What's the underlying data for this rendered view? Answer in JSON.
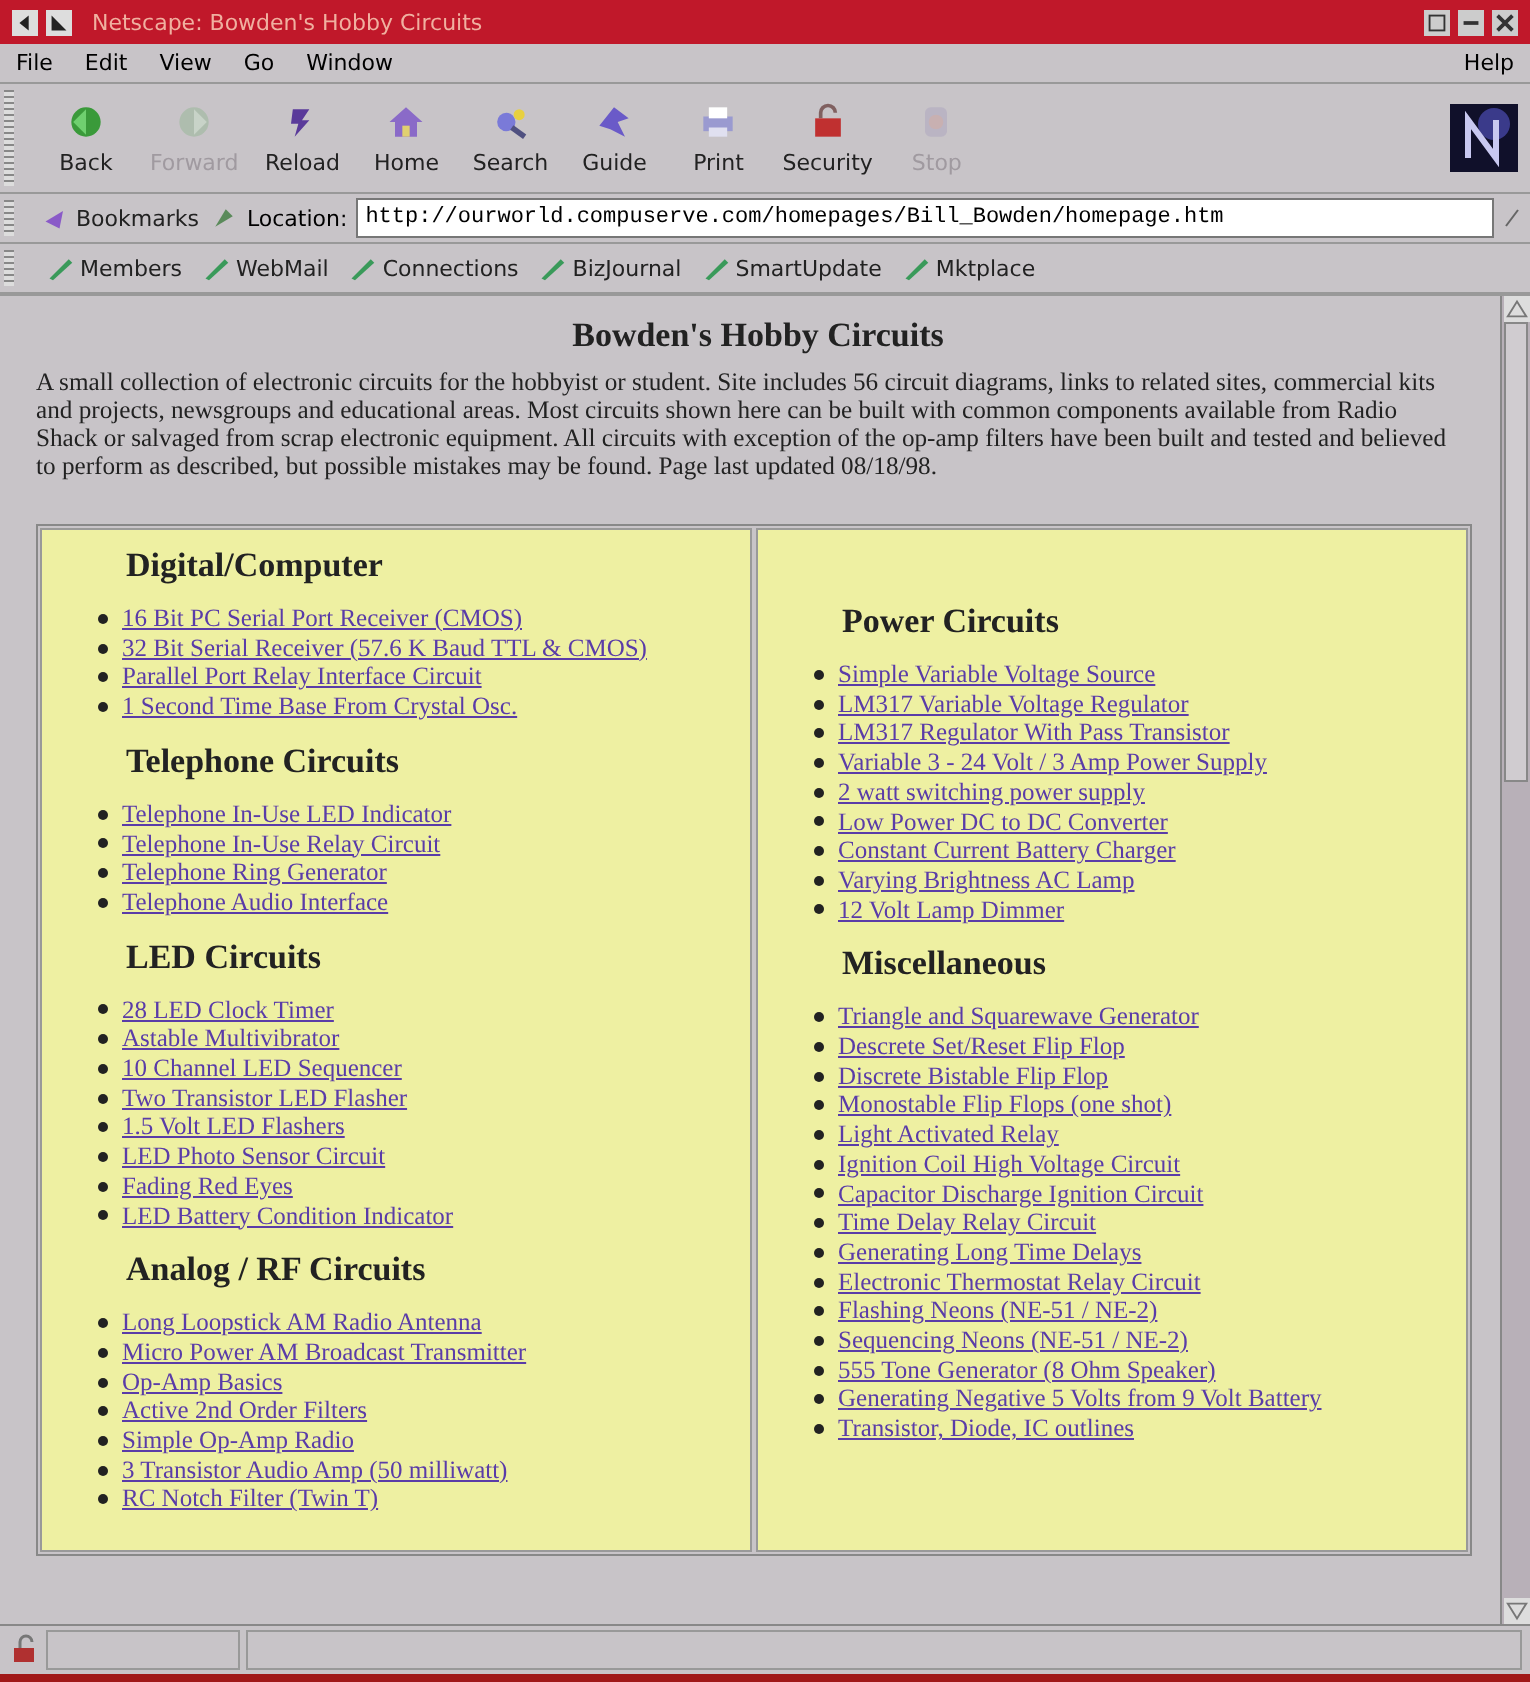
{
  "window": {
    "title": "Netscape: Bowden's Hobby Circuits"
  },
  "menu": {
    "items": [
      "File",
      "Edit",
      "View",
      "Go",
      "Window"
    ],
    "help": "Help"
  },
  "toolbar": [
    {
      "label": "Back",
      "disabled": false
    },
    {
      "label": "Forward",
      "disabled": true
    },
    {
      "label": "Reload",
      "disabled": false
    },
    {
      "label": "Home",
      "disabled": false
    },
    {
      "label": "Search",
      "disabled": false
    },
    {
      "label": "Guide",
      "disabled": false
    },
    {
      "label": "Print",
      "disabled": false
    },
    {
      "label": "Security",
      "disabled": false
    },
    {
      "label": "Stop",
      "disabled": true
    }
  ],
  "location_bar": {
    "bookmarks": "Bookmarks",
    "location_label": "Location:",
    "url": "http://ourworld.compuserve.com/homepages/Bill_Bowden/homepage.htm"
  },
  "personal_toolbar": [
    "Members",
    "WebMail",
    "Connections",
    "BizJournal",
    "SmartUpdate",
    "Mktplace"
  ],
  "page": {
    "title": "Bowden's Hobby Circuits",
    "intro": "A small collection of electronic circuits for the hobbyist or student. Site includes 56 circuit diagrams, links to related sites, commercial kits and projects, newsgroups and educational areas. Most circuits shown here can be built with common components available from Radio Shack or salvaged from scrap electronic equipment. All circuits with exception of the op-amp filters have been built and tested and believed to perform as described, but possible mistakes may be found. Page last updated 08/18/98.",
    "columns": [
      {
        "sections": [
          {
            "heading": "Digital/Computer",
            "links": [
              "16 Bit PC Serial Port Receiver (CMOS)",
              "32 Bit Serial Receiver (57.6 K Baud TTL & CMOS)",
              "Parallel Port Relay Interface Circuit",
              "1 Second Time Base From Crystal Osc."
            ]
          },
          {
            "heading": "Telephone Circuits",
            "links": [
              "Telephone In-Use LED Indicator",
              "Telephone In-Use Relay Circuit",
              "Telephone Ring Generator",
              "Telephone Audio Interface"
            ]
          },
          {
            "heading": "LED Circuits",
            "links": [
              "28 LED Clock Timer",
              "Astable Multivibrator",
              "10 Channel LED Sequencer",
              "Two Transistor LED Flasher",
              "1.5 Volt LED Flashers",
              "LED Photo Sensor Circuit",
              "Fading Red Eyes",
              "LED Battery Condition Indicator"
            ]
          },
          {
            "heading": "Analog / RF Circuits",
            "links": [
              "Long Loopstick AM Radio Antenna",
              "Micro Power AM Broadcast Transmitter",
              "Op-Amp Basics",
              "Active 2nd Order Filters",
              "Simple Op-Amp Radio",
              "3 Transistor Audio Amp (50 milliwatt)",
              "RC Notch Filter (Twin T)"
            ]
          }
        ]
      },
      {
        "sections": [
          {
            "heading": "Power Circuits",
            "links": [
              "Simple Variable Voltage Source",
              "LM317 Variable Voltage Regulator",
              "LM317 Regulator With Pass Transistor",
              "Variable 3 - 24 Volt / 3 Amp Power Supply",
              "2 watt switching power supply",
              "Low Power DC to DC Converter",
              "Constant Current Battery Charger",
              "Varying Brightness AC Lamp",
              "12 Volt Lamp Dimmer"
            ]
          },
          {
            "heading": "Miscellaneous",
            "links": [
              "Triangle and Squarewave Generator",
              "Descrete Set/Reset Flip Flop",
              "Discrete Bistable Flip Flop",
              "Monostable Flip Flops (one shot)",
              "Light Activated Relay",
              "Ignition Coil High Voltage Circuit",
              "Capacitor Discharge Ignition Circuit",
              "Time Delay Relay Circuit",
              "Generating Long Time Delays",
              "Electronic Thermostat Relay Circuit",
              "Flashing Neons (NE-51 / NE-2)",
              "Sequencing Neons (NE-51 / NE-2)",
              "555 Tone Generator (8 Ohm Speaker)",
              "Generating Negative 5 Volts from 9 Volt Battery",
              "Transistor, Diode, IC outlines"
            ]
          }
        ]
      }
    ]
  }
}
